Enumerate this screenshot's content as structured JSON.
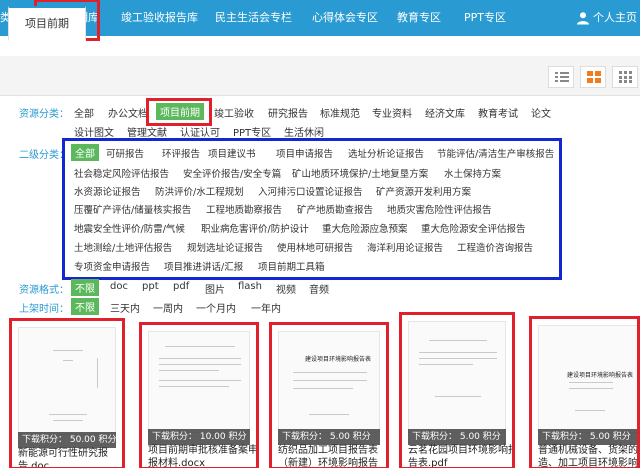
{
  "nav": {
    "left_partial": "类",
    "items": [
      "项目前期库",
      "竣工验收报告库",
      "民主生活会专栏",
      "心得体会专区",
      "教育专区",
      "PPT专区"
    ],
    "user": "个人主页"
  },
  "tab": {
    "active": "项目前期"
  },
  "filters": {
    "source_label": "资源分类：",
    "source_row1": [
      "全部",
      "办公文档",
      "项目前期",
      "竣工验收",
      "研究报告",
      "标准规范",
      "专业资料",
      "经济文库",
      "教育考试",
      "论文"
    ],
    "source_row2": [
      "设计图文",
      "管理文献",
      "认证认可",
      "PPT专区",
      "生活休闲"
    ],
    "sub_label": "二级分类：",
    "sub_rows": [
      [
        "全部",
        "可研报告",
        "环评报告",
        "项目建议书",
        "项目申请报告",
        "选址分析论证报告",
        "节能评估/清洁生产审核报告"
      ],
      [
        "社会稳定风险评估报告",
        "安全评价报告/安全专篇",
        "矿山地质环境保护/土地复垦方案",
        "水土保持方案"
      ],
      [
        "水资源论证报告",
        "防洪评价/水工程规划",
        "入河排污口设置论证报告",
        "矿产资源开发利用方案"
      ],
      [
        "压覆矿产评估/储量核实报告",
        "工程地质勘察报告",
        "矿产地质勘查报告",
        "地质灾害危险性评估报告"
      ],
      [
        "地震安全性评价/防雷/气候",
        "职业病危害评价/防护设计",
        "重大危险源应急预案",
        "重大危险源安全评估报告"
      ],
      [
        "土地测绘/土地评估报告",
        "规划选址论证报告",
        "使用林地可研报告",
        "海洋利用论证报告",
        "工程造价咨询报告"
      ],
      [
        "专项资金申请报告",
        "项目推进讲话/汇报",
        "项目前期工具箱"
      ]
    ],
    "format_label": "资源格式：",
    "formats": [
      "不限",
      "doc",
      "ppt",
      "pdf",
      "图片",
      "flash",
      "视频",
      "音频"
    ],
    "time_label": "上架时间：",
    "times": [
      "不限",
      "三天内",
      "一周内",
      "一个月内",
      "一年内"
    ]
  },
  "cards": [
    {
      "price": "下载积分： 50.00 积分",
      "caption1": "新能源可行性研究报",
      "caption2": "告.doc"
    },
    {
      "price": "下载积分： 10.00 积分",
      "caption1": "项目前期审批核准备案申",
      "caption2": "报材料.docx"
    },
    {
      "price": "下载积分： 5.00 积分",
      "caption1": "纺织品加工项目报告表",
      "caption2": "（新建）环境影响报告"
    },
    {
      "price": "下载积分： 5.00 积分",
      "caption1": "云茗花园项目环境影响报",
      "caption2": "告表.pdf"
    },
    {
      "price": "下载积分： 5.00 积分",
      "caption1": "普通机械设备、货架的制",
      "caption2": "造、加工项目环境影响报"
    }
  ]
}
